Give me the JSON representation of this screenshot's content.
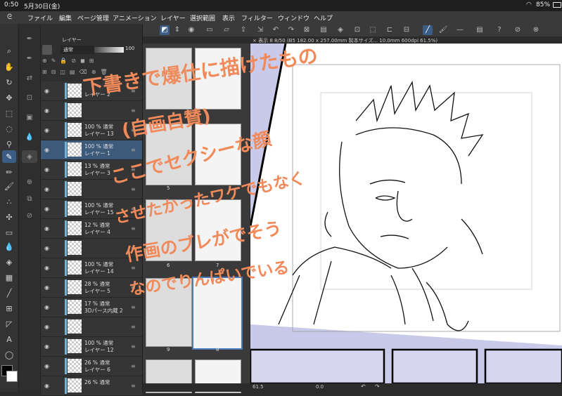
{
  "status": {
    "time": "0:50",
    "date": "5月30日(金)",
    "battery": "85%"
  },
  "menu": [
    "ファイル",
    "編集",
    "ページ管理",
    "アニメーション",
    "レイヤー",
    "選択範囲",
    "表示",
    "フィルター",
    "ウィンドウ",
    "ヘルプ"
  ],
  "layer_panel": {
    "title": "レイヤー",
    "blend_mode": "通常",
    "opacity": "100",
    "layers": [
      {
        "line1": "",
        "line2": "レイヤー 2"
      },
      {
        "line1": "",
        "line2": ""
      },
      {
        "line1": "100 % 通常",
        "line2": "レイヤー 13"
      },
      {
        "line1": "100 % 通常",
        "line2": "レイヤー 1"
      },
      {
        "line1": "13 % 通常",
        "line2": "レイヤー 3"
      },
      {
        "line1": "",
        "line2": ""
      },
      {
        "line1": "100 % 通常",
        "line2": "レイヤー 15"
      },
      {
        "line1": "12 % 通常",
        "line2": "レイヤー 4"
      },
      {
        "line1": "",
        "line2": ""
      },
      {
        "line1": "100 % 通常",
        "line2": "レイヤー 14"
      },
      {
        "line1": "28 % 通常",
        "line2": "レイヤー 5"
      },
      {
        "line1": "17 % 通常",
        "line2": "3Dパース内蔵 2"
      },
      {
        "line1": "",
        "line2": ""
      },
      {
        "line1": "100 % 通常",
        "line2": "レイヤー 12"
      },
      {
        "line1": "26 % 通常",
        "line2": "レイヤー 6"
      },
      {
        "line1": "26 % 通常",
        "line2": ""
      }
    ]
  },
  "pages": {
    "header": "表示 8",
    "numbers": [
      "5",
      "6",
      "7",
      "8",
      "9"
    ]
  },
  "canvas": {
    "tab": "× 表示 8 8/50 (B5 182.00 x 257.00mm 製本サイズ... 10.0mm 600dpi 61.5%)",
    "zoom": "61.5",
    "bottom_val": "0.0"
  },
  "handwriting": [
    "下書きで爆仕に描けたもの",
    "(自画自賛)",
    "ここでセクシーな顔",
    "させたかったワケでもなく",
    "作画のブレがでそう",
    "なのでりんぱいでいる"
  ],
  "colors": {
    "accent": "#3b5d85",
    "handwriting": "#f08a5a",
    "canvas_bg": "#c9c9e9"
  }
}
